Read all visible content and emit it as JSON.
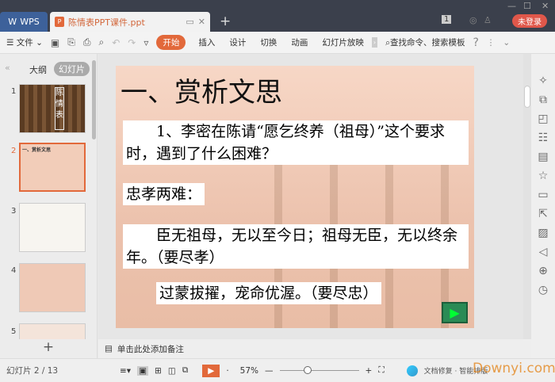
{
  "titlebar": {
    "app_tab": "WPS",
    "doc_tab": "陈情表PPT课件.ppt",
    "login": "未登录",
    "badge": "1",
    "new_tab": "+"
  },
  "toolbar": {
    "file": "文件",
    "tabs": [
      "开始",
      "插入",
      "设计",
      "切换",
      "动画",
      "幻灯片放映"
    ],
    "search": "查找命令、搜索模板",
    "help": "?"
  },
  "leftpanel": {
    "tabs": [
      "大纲",
      "幻灯片"
    ],
    "slide_numbers": [
      "1",
      "2",
      "3",
      "4",
      "5"
    ],
    "thumb1_title": "陈情表",
    "add": "+"
  },
  "slide": {
    "title": "一、赏析文思",
    "q": "　　1、李密在陈请“愿乞终养（祖母）”这个要求时，遇到了什么困难？",
    "dilemma": "忠孝两难：",
    "filial": "　　臣无祖母，无以至今日；祖母无臣，无以终余年。（要尽孝）",
    "loyal": "过蒙拔擢，宠命优渥。（要尽忠）"
  },
  "notes": {
    "placeholder": "单击此处添加备注"
  },
  "status": {
    "slide_indicator": "幻灯片 2 / 13",
    "zoom": "57%",
    "zoom_fraction": 0.3,
    "watermark": "Downyi.com",
    "right_text": "文档修复 · 智能排版"
  }
}
